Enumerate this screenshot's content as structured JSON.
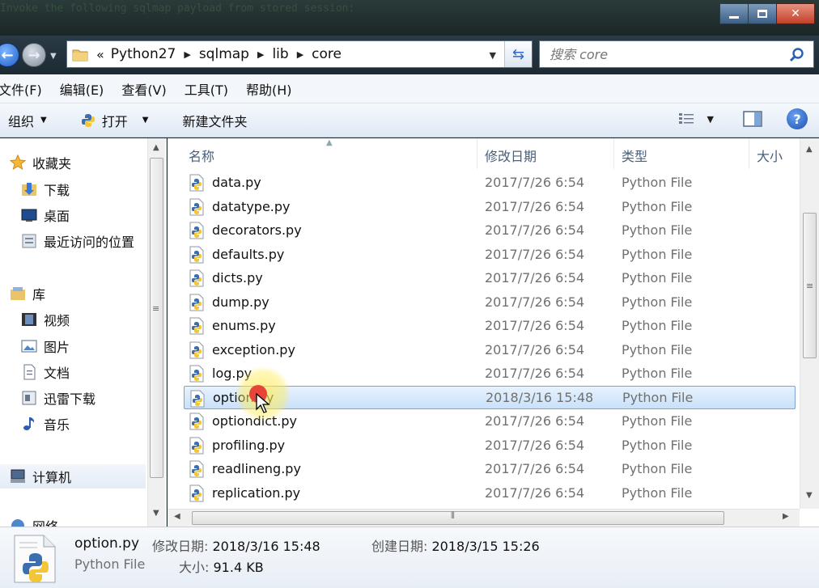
{
  "window": {
    "ghost_text": [
      "Invoke the following sqlmap payload from stored session:"
    ]
  },
  "address": {
    "overflow": "«",
    "crumbs": [
      "Python27",
      "sqlmap",
      "lib",
      "core"
    ],
    "search_placeholder": "搜索 core"
  },
  "menu": [
    "文件(F)",
    "编辑(E)",
    "查看(V)",
    "工具(T)",
    "帮助(H)"
  ],
  "toolbar": {
    "organize": "组织",
    "open": "打开",
    "new_folder": "新建文件夹"
  },
  "nav": {
    "favorites": "收藏夹",
    "downloads": "下载",
    "desktop": "桌面",
    "recent": "最近访问的位置",
    "libraries": "库",
    "videos": "视频",
    "pictures": "图片",
    "documents": "文档",
    "xunlei": "迅雷下载",
    "music": "音乐",
    "computer": "计算机",
    "network": "网络"
  },
  "columns": {
    "name": "名称",
    "date": "修改日期",
    "type": "类型",
    "size": "大小"
  },
  "files": [
    {
      "name": "data.py",
      "date": "2017/7/26 6:54",
      "type": "Python File"
    },
    {
      "name": "datatype.py",
      "date": "2017/7/26 6:54",
      "type": "Python File"
    },
    {
      "name": "decorators.py",
      "date": "2017/7/26 6:54",
      "type": "Python File"
    },
    {
      "name": "defaults.py",
      "date": "2017/7/26 6:54",
      "type": "Python File"
    },
    {
      "name": "dicts.py",
      "date": "2017/7/26 6:54",
      "type": "Python File"
    },
    {
      "name": "dump.py",
      "date": "2017/7/26 6:54",
      "type": "Python File"
    },
    {
      "name": "enums.py",
      "date": "2017/7/26 6:54",
      "type": "Python File"
    },
    {
      "name": "exception.py",
      "date": "2017/7/26 6:54",
      "type": "Python File"
    },
    {
      "name": "log.py",
      "date": "2017/7/26 6:54",
      "type": "Python File"
    },
    {
      "name": "option.py",
      "date": "2018/3/16 15:48",
      "type": "Python File",
      "selected": true
    },
    {
      "name": "optiondict.py",
      "date": "2017/7/26 6:54",
      "type": "Python File"
    },
    {
      "name": "profiling.py",
      "date": "2017/7/26 6:54",
      "type": "Python File"
    },
    {
      "name": "readlineng.py",
      "date": "2017/7/26 6:54",
      "type": "Python File"
    },
    {
      "name": "replication.py",
      "date": "2017/7/26 6:54",
      "type": "Python File"
    }
  ],
  "details": {
    "name": "option.py",
    "type": "Python File",
    "modified_label": "修改日期:",
    "modified_value": "2018/3/16 15:48",
    "created_label": "创建日期:",
    "created_value": "2018/3/15 15:26",
    "size_label": "大小:",
    "size_value": "91.4 KB"
  },
  "colors": {
    "accent": "#3a78d6",
    "selection": "#c9e1fa",
    "python_blue": "#3b6fb0",
    "python_yellow": "#f3c63a"
  }
}
